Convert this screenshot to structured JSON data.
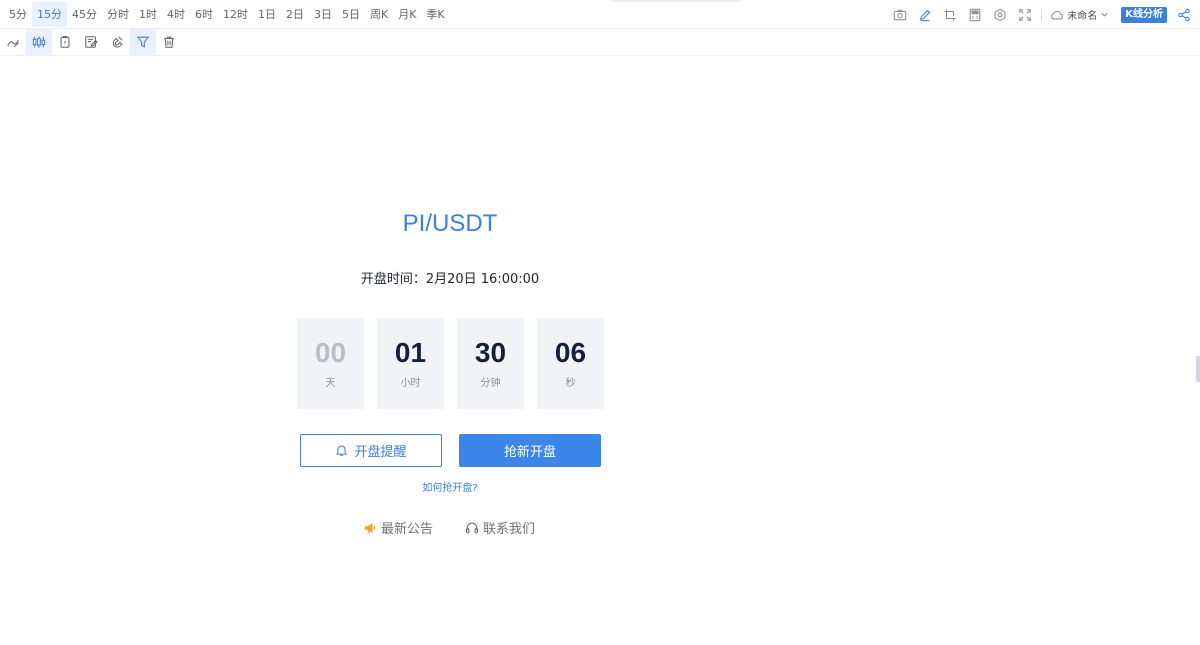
{
  "toolbar": {
    "intervals": [
      {
        "label": "5分"
      },
      {
        "label": "15分"
      },
      {
        "label": "45分"
      },
      {
        "label": "分时"
      },
      {
        "label": "1时"
      },
      {
        "label": "4时"
      },
      {
        "label": "6时"
      },
      {
        "label": "12时"
      },
      {
        "label": "1日"
      },
      {
        "label": "2日"
      },
      {
        "label": "3日"
      },
      {
        "label": "5日"
      },
      {
        "label": "周K"
      },
      {
        "label": "月K"
      },
      {
        "label": "季K"
      }
    ],
    "active_interval": "15分",
    "layout_name": "未命名",
    "kline_badge": "K线分析"
  },
  "icons": {
    "top_right": [
      "camera-icon",
      "pencil-icon",
      "crop-icon",
      "calculator-icon",
      "settings-icon",
      "fullscreen-icon",
      "cloud-icon"
    ],
    "drawing": [
      "draw-line-icon",
      "candlestick-icon",
      "clipboard-icon",
      "note-edit-icon",
      "magnet-icon",
      "filter-icon",
      "trash-icon"
    ]
  },
  "listing": {
    "pair": "PI/USDT",
    "open_time": "开盘时间：2月20日 16:00:00",
    "countdown": {
      "days": {
        "value": "00",
        "unit": "天"
      },
      "hours": {
        "value": "01",
        "unit": "小时"
      },
      "minutes": {
        "value": "30",
        "unit": "分钟"
      },
      "seconds": {
        "value": "06",
        "unit": "秒"
      }
    },
    "remind_button": "开盘提醒",
    "grab_button": "抢新开盘",
    "how_link": "如何抢开盘?",
    "announcement_link": "最新公告",
    "contact_link": "联系我们"
  },
  "colors": {
    "accent": "#3c7fdd",
    "primary_button": "#3c86ea",
    "countdown_bg": "#f1f3f6",
    "announcement_icon": "#f0a32f"
  }
}
